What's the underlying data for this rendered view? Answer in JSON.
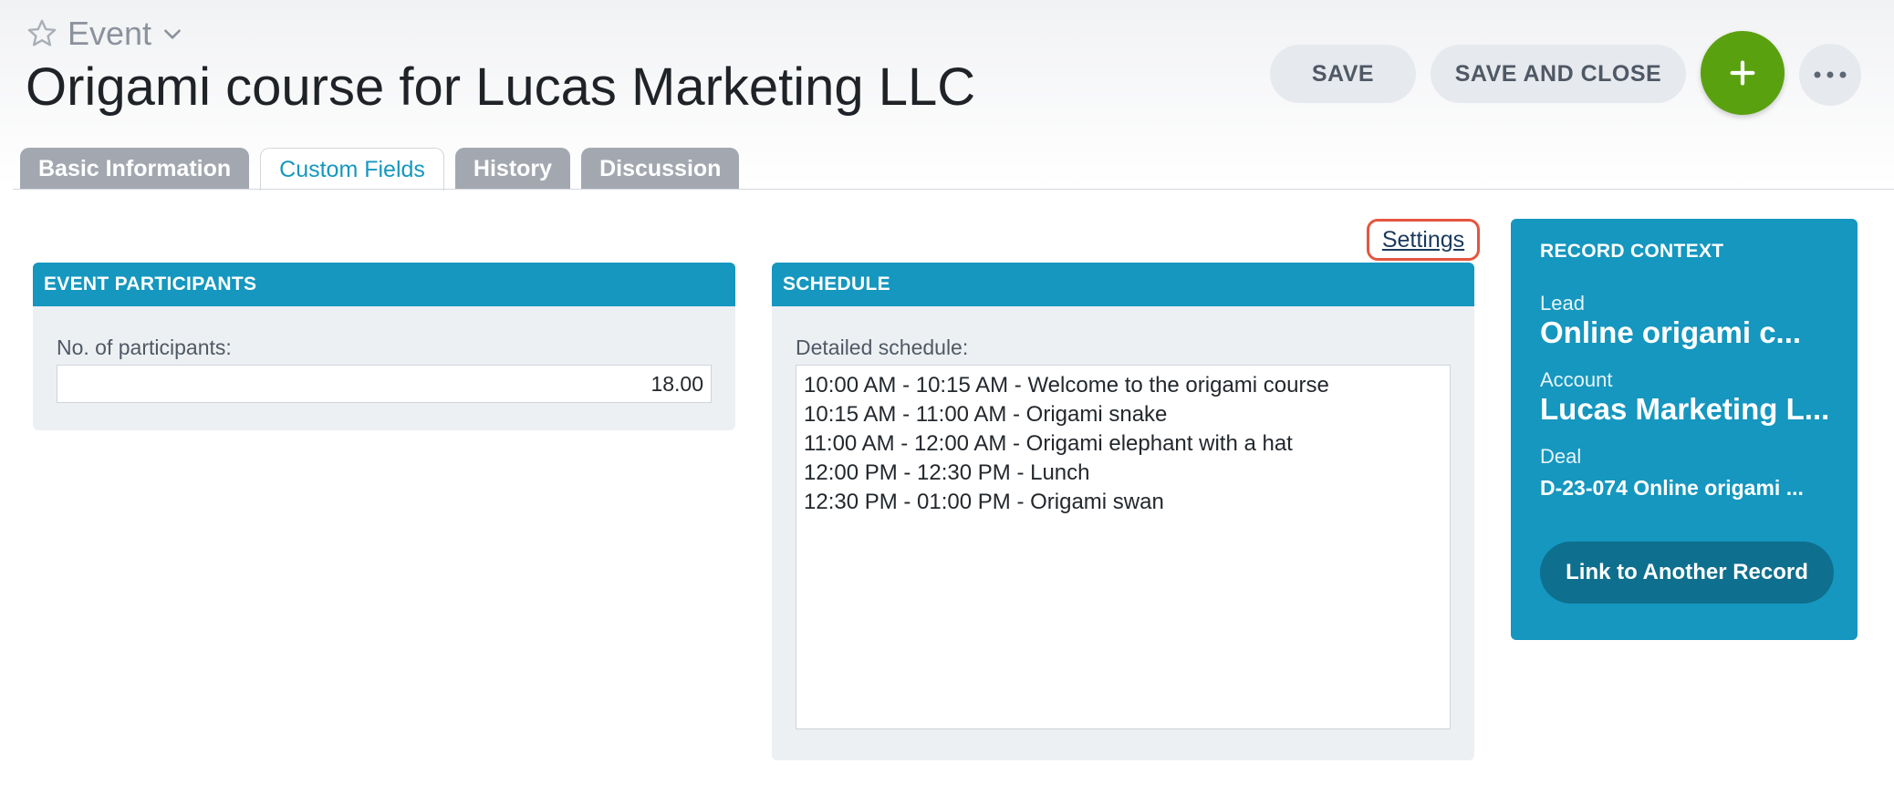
{
  "header": {
    "record_type": "Event",
    "title": "Origami course for Lucas Marketing LLC",
    "icons": {
      "favorite": "star-icon",
      "type_menu": "chevron-down-icon",
      "add": "plus-icon",
      "more": "more-horizontal-icon"
    }
  },
  "toolbar": {
    "save_label": "SAVE",
    "save_close_label": "SAVE AND CLOSE",
    "accent_color": "#5aa10f"
  },
  "tabs": [
    {
      "label": "Basic Information",
      "active": false
    },
    {
      "label": "Custom Fields",
      "active": true
    },
    {
      "label": "History",
      "active": false
    },
    {
      "label": "Discussion",
      "active": false
    }
  ],
  "settings_label": "Settings",
  "participants_panel": {
    "title": "EVENT PARTICIPANTS",
    "field_label": "No. of participants:",
    "field_value": "18.00"
  },
  "schedule_panel": {
    "title": "SCHEDULE",
    "field_label": "Detailed schedule:",
    "lines": [
      "10:00 AM - 10:15 AM - Welcome to the origami course",
      "10:15 AM - 11:00 AM - Origami snake",
      "11:00 AM - 12:00 AM - Origami elephant with a hat",
      "12:00 PM - 12:30 PM - Lunch",
      "12:30 PM - 01:00 PM - Origami swan"
    ]
  },
  "record_context": {
    "title": "RECORD CONTEXT",
    "lead_label": "Lead",
    "lead_value": "Online origami c...",
    "account_label": "Account",
    "account_value": "Lucas Marketing L...",
    "deal_label": "Deal",
    "deal_value": "D-23-074 Online origami ...",
    "link_button": "Link to Another Record",
    "card_color": "#1597bf"
  }
}
